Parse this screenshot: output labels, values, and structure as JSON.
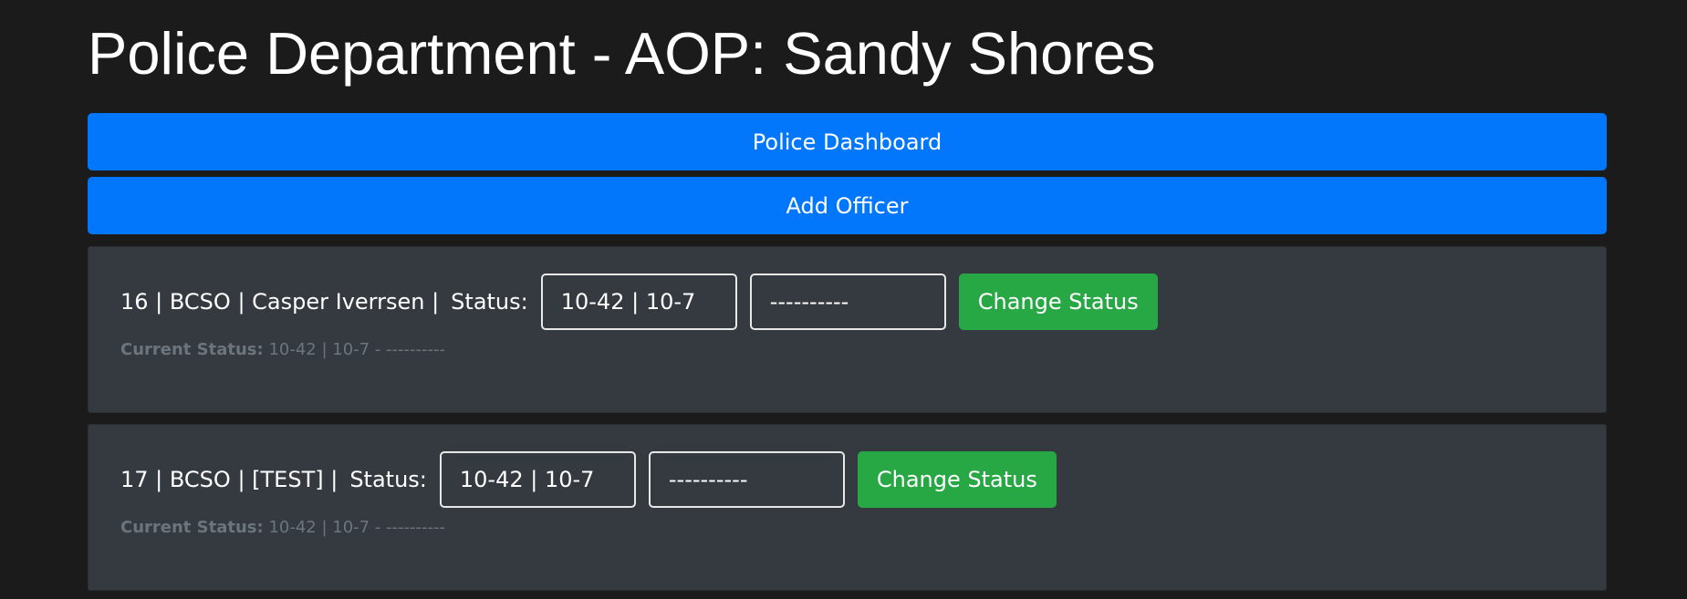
{
  "page": {
    "title": "Police Department - AOP: Sandy Shores"
  },
  "nav": {
    "dashboard_label": "Police Dashboard",
    "add_officer_label": "Add Officer"
  },
  "officers": [
    {
      "info": "16 | BCSO | Casper Iverrsen |",
      "status_label": "Status:",
      "status_code": "10-42 | 10-7",
      "status_detail": "----------",
      "change_label": "Change Status",
      "current_status_label": "Current Status:",
      "current_status_value": "10-42 | 10-7 - ----------"
    },
    {
      "info": "17 | BCSO | [TEST] |",
      "status_label": "Status:",
      "status_code": "10-42 | 10-7",
      "status_detail": "----------",
      "change_label": "Change Status",
      "current_status_label": "Current Status:",
      "current_status_value": "10-42 | 10-7 - ----------"
    }
  ],
  "colors": {
    "background": "#1b1b1b",
    "primary": "#0277fc",
    "success": "#28a745",
    "card": "#343a40",
    "muted": "#6c757d"
  }
}
